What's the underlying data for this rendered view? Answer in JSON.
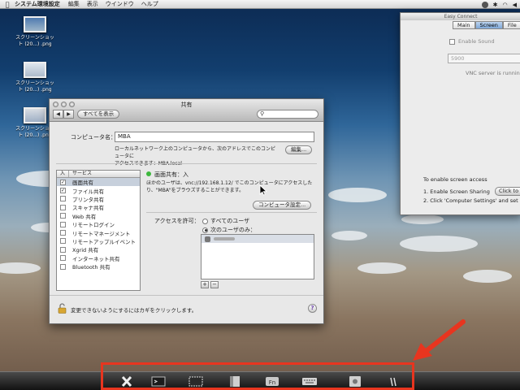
{
  "menubar": {
    "app": "システム環境設定",
    "items": [
      "編集",
      "表示",
      "ウインドウ",
      "ヘルプ"
    ]
  },
  "desktop_icons": [
    {
      "line1": "スクリーンショッ",
      "line2": "ト (20...) .png"
    },
    {
      "line1": "スクリーンショッ",
      "line2": "ト (20...) .png"
    },
    {
      "line1": "スクリーンショッ",
      "line2": "ト (20...) .png"
    }
  ],
  "sharing": {
    "title": "共有",
    "show_all": "すべてを表示",
    "computer_name_label": "コンピュータ名：",
    "computer_name_value": "MBA",
    "address_note_1": "ローカルネットワーク上のコンピュータから、次のアドレスでこのコンピュータに",
    "address_note_2": "アクセスできます：MBA.local",
    "edit_button": "編集...",
    "list_header_on": "入",
    "list_header_service": "サービス",
    "services": [
      {
        "name": "画面共有",
        "on": true,
        "selected": true
      },
      {
        "name": "ファイル共有",
        "on": true,
        "selected": false
      },
      {
        "name": "プリンタ共有",
        "on": false,
        "selected": false
      },
      {
        "name": "スキャナ共有",
        "on": false,
        "selected": false
      },
      {
        "name": "Web 共有",
        "on": false,
        "selected": false
      },
      {
        "name": "リモートログイン",
        "on": false,
        "selected": false
      },
      {
        "name": "リモートマネージメント",
        "on": false,
        "selected": false
      },
      {
        "name": "リモートアップルイベント",
        "on": false,
        "selected": false
      },
      {
        "name": "Xgrid 共有",
        "on": false,
        "selected": false
      },
      {
        "name": "インターネット共有",
        "on": false,
        "selected": false
      },
      {
        "name": "Bluetooth 共有",
        "on": false,
        "selected": false
      }
    ],
    "status": "画面共有：入",
    "desc_1": "ほかのユーザは、vnc://192.168.1.12/ でこのコンピュータにアクセスした",
    "desc_2": "り、\"MBA\"をブラウズすることができます。",
    "computer_settings_button": "コンピュータ設定...",
    "access_label": "アクセスを許可：",
    "radio_all": "すべてのユーザ",
    "radio_only": "次のユーザのみ：",
    "plus": "+",
    "minus": "−",
    "lock_text": "変更できないようにするにはカギをクリックします。",
    "help": "?"
  },
  "easy_connect": {
    "title": "Easy Connect",
    "tabs": [
      {
        "label": "Main",
        "active": false
      },
      {
        "label": "Screen",
        "active": true
      },
      {
        "label": "File",
        "active": false
      }
    ],
    "enable_sound": "Enable Sound",
    "port": "5900",
    "status": "VNC server is runnin",
    "to_enable": "To enable screen access",
    "step1": "1.  Enable Screen Sharing",
    "step1_button": "Click to o",
    "step2": "2.  Click 'Computer Settings' and set a"
  },
  "dock_icons": [
    "close-icon",
    "terminal-icon",
    "display-icon",
    "window-icon",
    "fn-key-icon",
    "keyboard-icon",
    "preferences-icon",
    "more-icon"
  ],
  "colors": {
    "highlight": "#e8351f",
    "status_on": "#3db83d"
  }
}
